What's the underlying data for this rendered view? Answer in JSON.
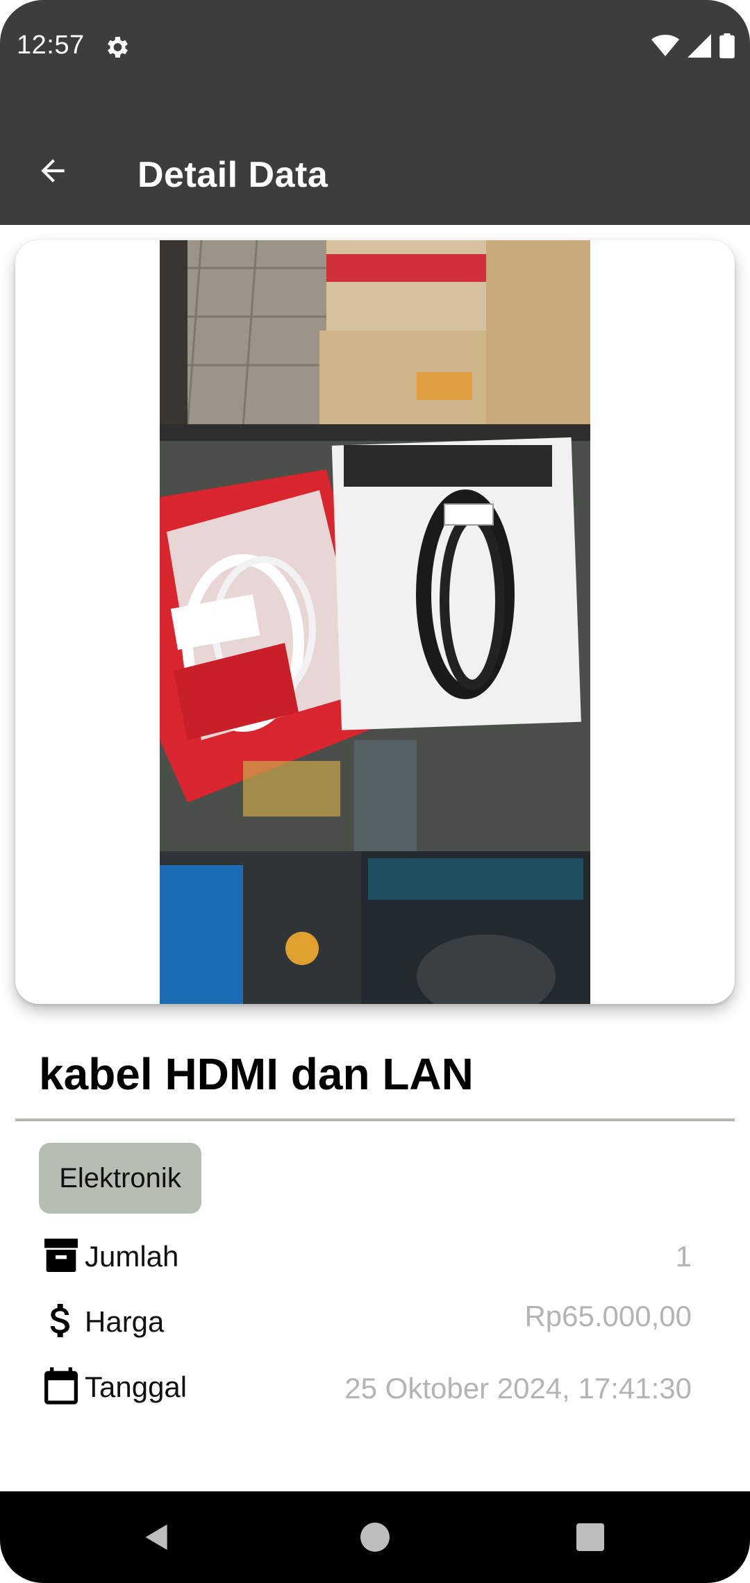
{
  "status_bar": {
    "time": "12:57",
    "icons": [
      "settings-gear-icon",
      "wifi-icon",
      "signal-icon",
      "battery-icon"
    ]
  },
  "app_bar": {
    "back_icon": "arrow-back-icon",
    "title": "Detail Data"
  },
  "item": {
    "photo_description_icon": "product-photo",
    "name": "kabel HDMI dan LAN",
    "category": "Elektronik",
    "fields": {
      "jumlah": {
        "icon": "archive-box-icon",
        "label": "Jumlah",
        "value": "1"
      },
      "harga": {
        "icon": "dollar-sign-icon",
        "label": "Harga",
        "value": "Rp65.000,00"
      },
      "tanggal": {
        "icon": "calendar-icon",
        "label": "Tanggal",
        "value": "25 Oktober 2024, 17:41:30"
      }
    }
  },
  "nav_bar": {
    "icons": [
      "nav-back-icon",
      "nav-home-icon",
      "nav-recents-icon"
    ]
  },
  "colors": {
    "app_bar": "#3d3d3d",
    "chip": "#b6beb4",
    "value_text": "#b4b4b4",
    "divider": "#b0b8b0"
  }
}
